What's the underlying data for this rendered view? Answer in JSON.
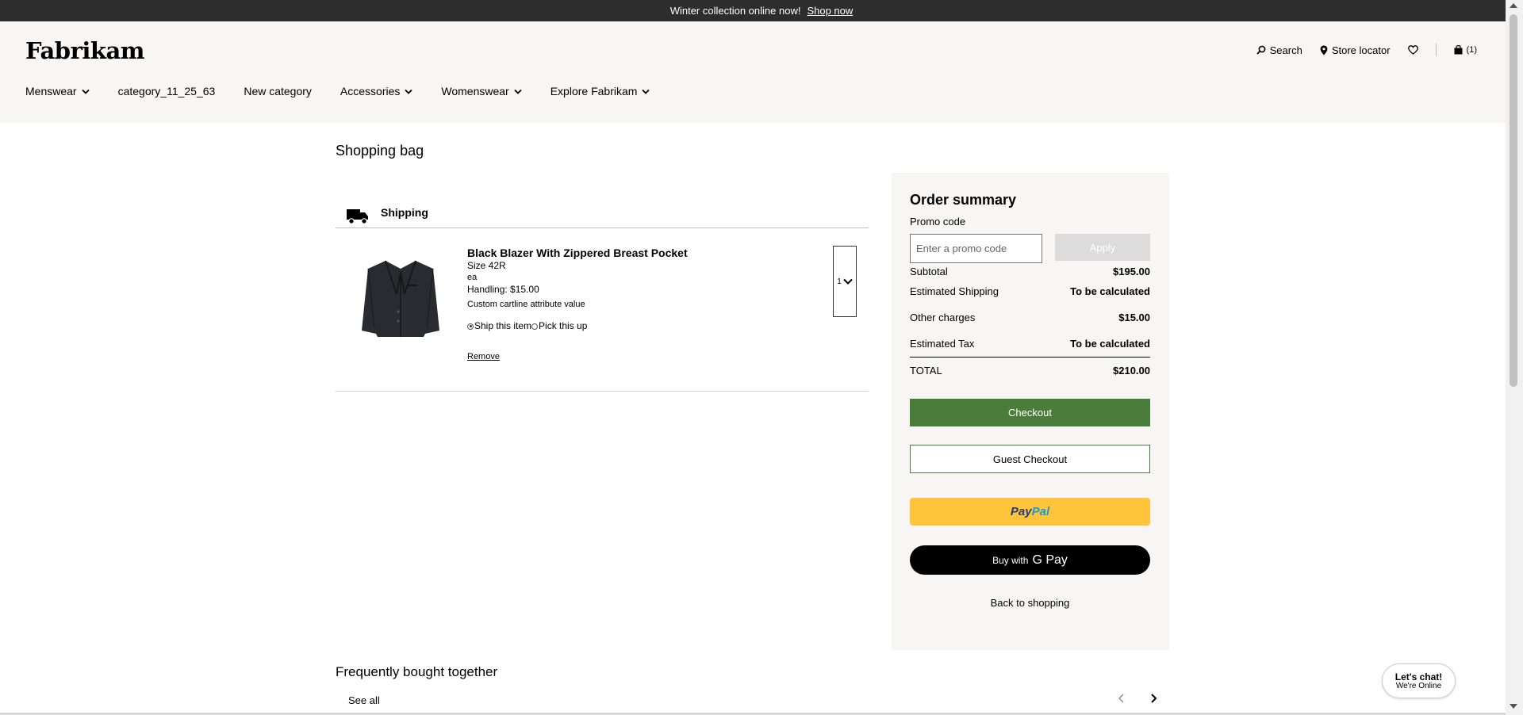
{
  "announcement": {
    "text": "Winter collection online now!",
    "link": "Shop now"
  },
  "header": {
    "logo": "Fabrikam",
    "utility": {
      "search": "Search",
      "store_locator": "Store locator",
      "cart_count": "(1)"
    },
    "nav": [
      "Menswear",
      "category_11_25_63",
      "New category",
      "Accessories",
      "Womenswear",
      "Explore Fabrikam"
    ]
  },
  "bag": {
    "title": "Shopping bag",
    "shipping_label": "Shipping",
    "item": {
      "name": "Black Blazer With Zippered Breast Pocket",
      "size": "Size 42R",
      "unit": "ea",
      "handling": "Handling: $15.00",
      "custom": "Custom cartline attribute value",
      "ship_option": "Ship this item",
      "pickup_option": "Pick this up",
      "remove": "Remove",
      "quantity": "1"
    }
  },
  "summary": {
    "title": "Order summary",
    "promo_label": "Promo code",
    "promo_placeholder": "Enter a promo code",
    "apply": "Apply",
    "subtotal_label": "Subtotal",
    "subtotal_value": "$195.00",
    "shipping_label": "Estimated Shipping",
    "shipping_value": "To be calculated",
    "other_label": "Other charges",
    "other_value": "$15.00",
    "tax_label": "Estimated Tax",
    "tax_value": "To be calculated",
    "total_label": "TOTAL",
    "total_value": "$210.00",
    "checkout": "Checkout",
    "guest_checkout": "Guest Checkout",
    "paypal_a": "Pay",
    "paypal_b": "Pal",
    "gpay_prefix": "Buy with",
    "gpay_brand": "G Pay",
    "back": "Back to shopping"
  },
  "fbt": {
    "title": "Frequently bought together",
    "see_all": "See all"
  },
  "chat": {
    "line1": "Let's chat!",
    "line2": "We're Online"
  },
  "colors": {
    "checkout_green": "#4a7c3a",
    "paypal_yellow": "#ffc439",
    "announce_bg": "#2d2d2d",
    "header_bg": "#f7f6f4"
  }
}
